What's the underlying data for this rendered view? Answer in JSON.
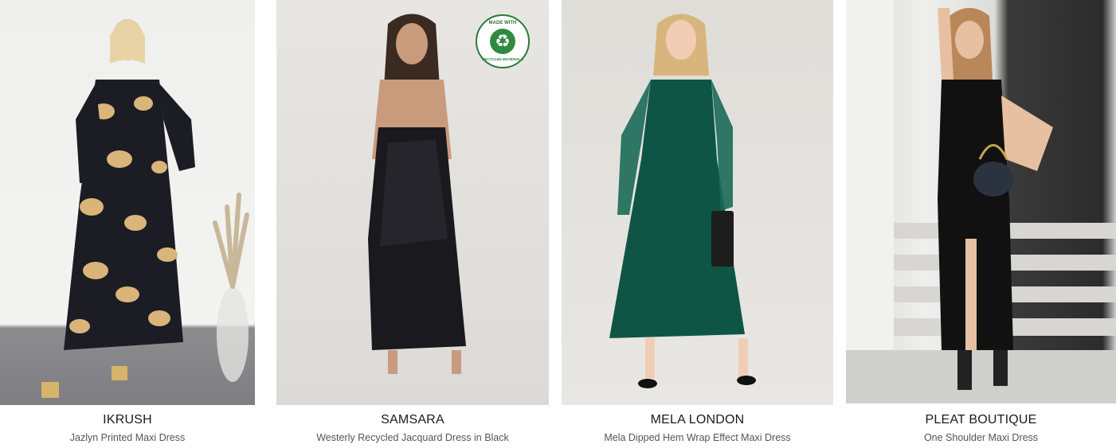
{
  "products": [
    {
      "brand": "IKRUSH",
      "name": "Jazlyn Printed Maxi Dress"
    },
    {
      "brand": "SAMSARA",
      "name": "Westerly Recycled Jacquard Dress in Black",
      "badge_top": "MADE WITH",
      "badge_bottom": "RECYCLED MATERIALS"
    },
    {
      "brand": "MELA LONDON",
      "name": "Mela Dipped Hem Wrap Effect Maxi Dress"
    },
    {
      "brand": "PLEAT BOUTIQUE",
      "name": "One Shoulder Maxi Dress"
    }
  ],
  "colors": {
    "brand_text": "#1a1a1a",
    "name_text": "#555555",
    "recycle_green": "#2f8a40"
  }
}
